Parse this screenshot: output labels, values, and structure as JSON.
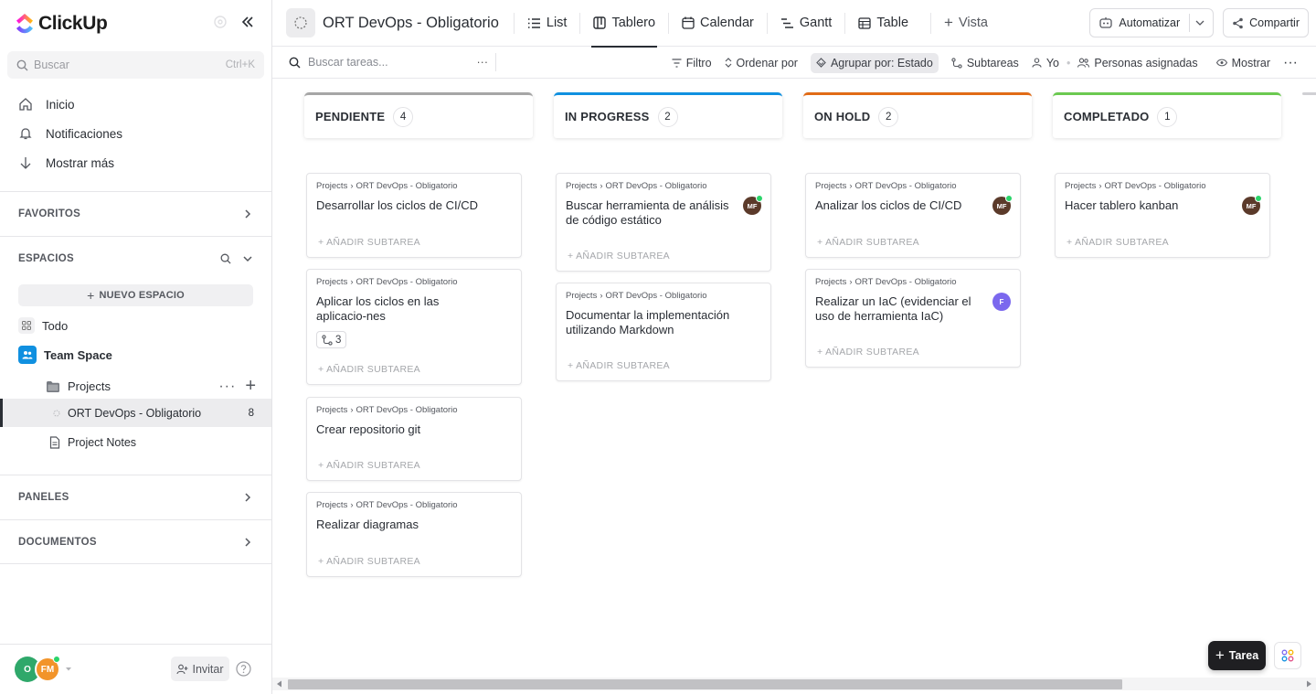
{
  "app": {
    "name": "ClickUp"
  },
  "sidebar": {
    "search": {
      "placeholder": "Buscar",
      "shortcut": "Ctrl+K"
    },
    "nav": [
      {
        "label": "Inicio",
        "icon": "home-icon"
      },
      {
        "label": "Notificaciones",
        "icon": "bell-icon"
      },
      {
        "label": "Mostrar más",
        "icon": "arrow-down-icon"
      }
    ],
    "sections": {
      "favoritos": "FAVORITOS",
      "espacios": "ESPACIOS",
      "paneles": "PANELES",
      "documentos": "DOCUMENTOS"
    },
    "new_space": "NUEVO ESPACIO",
    "tree": {
      "todo": "Todo",
      "team_space": "Team Space",
      "projects": "Projects",
      "list": "ORT DevOps - Obligatorio",
      "list_count": "8",
      "notes": "Project Notes"
    },
    "avatars": {
      "o": "O",
      "fm": "FM"
    },
    "invite": "Invitar"
  },
  "header": {
    "title": "ORT DevOps - Obligatorio",
    "views": [
      {
        "label": "List",
        "icon": "list-icon"
      },
      {
        "label": "Tablero",
        "icon": "board-icon",
        "active": true
      },
      {
        "label": "Calendar",
        "icon": "calendar-icon"
      },
      {
        "label": "Gantt",
        "icon": "gantt-icon"
      },
      {
        "label": "Table",
        "icon": "table-icon"
      }
    ],
    "add_view": "Vista",
    "automate": "Automatizar",
    "share": "Compartir"
  },
  "toolbar": {
    "search_placeholder": "Buscar tareas...",
    "filter": "Filtro",
    "sort": "Ordenar por",
    "group": "Agrupar por: Estado",
    "subtasks": "Subtareas",
    "me": "Yo",
    "assignees": "Personas asignadas",
    "show": "Mostrar"
  },
  "board": {
    "breadcrumb_space": "Projects",
    "breadcrumb_list": "ORT DevOps - Obligatorio",
    "add_subtask": "+ AÑADIR SUBTAREA",
    "columns": [
      {
        "name": "PENDIENTE",
        "count": "4",
        "color": "#a6a6a6",
        "cards": [
          {
            "title": "Desarrollar los ciclos de CI/CD"
          },
          {
            "title": "Aplicar los ciclos en las aplicacio-nes",
            "subtasks": "3"
          },
          {
            "title": "Crear repositorio git"
          },
          {
            "title": "Realizar diagramas"
          }
        ]
      },
      {
        "name": "IN PROGRESS",
        "count": "2",
        "color": "#1090e0",
        "cards": [
          {
            "title": "Buscar herramienta de análisis de código estático",
            "avatar": "MF"
          },
          {
            "title": "Documentar la implementación utilizando Markdown"
          }
        ]
      },
      {
        "name": "ON HOLD",
        "count": "2",
        "color": "#e16b16",
        "cards": [
          {
            "title": "Analizar los ciclos de CI/CD",
            "avatar": "MF"
          },
          {
            "title": "Realizar un IaC (evidenciar el uso de herramienta IaC)",
            "avatar": "F"
          }
        ]
      },
      {
        "name": "COMPLETADO",
        "count": "1",
        "color": "#6bc950",
        "cards": [
          {
            "title": "Hacer tablero kanban",
            "avatar": "MF"
          }
        ]
      }
    ]
  },
  "fab": {
    "label": "Tarea"
  }
}
